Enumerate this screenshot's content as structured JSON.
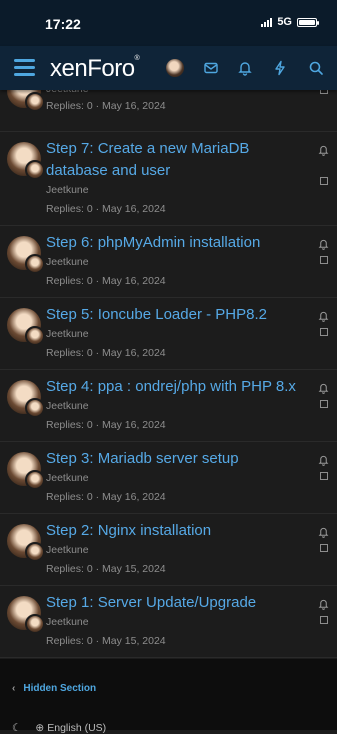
{
  "status_bar": {
    "time": "17:22",
    "network": "5G"
  },
  "header": {
    "logo": "xenForo"
  },
  "threads": [
    {
      "title": "",
      "author": "Jeetkune",
      "meta": "Replies: 0 · May 16, 2024"
    },
    {
      "title": "Step 7: Create a new MariaDB database and user",
      "author": "Jeetkune",
      "meta": "Replies: 0 · May 16, 2024"
    },
    {
      "title": "Step 6: phpMyAdmin installation",
      "author": "Jeetkune",
      "meta": "Replies: 0 · May 16, 2024"
    },
    {
      "title": "Step 5: Ioncube Loader - PHP8.2",
      "author": "Jeetkune",
      "meta": "Replies: 0 · May 16, 2024"
    },
    {
      "title": "Step 4: ppa : ondrej/php with PHP 8.x",
      "author": "Jeetkune",
      "meta": "Replies: 0 · May 16, 2024"
    },
    {
      "title": "Step 3: Mariadb server setup",
      "author": "Jeetkune",
      "meta": "Replies: 0 · May 16, 2024"
    },
    {
      "title": "Step 2: Nginx installation",
      "author": "Jeetkune",
      "meta": "Replies: 0 · May 15, 2024"
    },
    {
      "title": "Step 1: Server Update/Upgrade",
      "author": "Jeetkune",
      "meta": "Replies: 0 · May 15, 2024"
    }
  ],
  "footer": {
    "section_link": "Hidden Section",
    "language": "English (US)"
  },
  "colors": {
    "link": "#56a9e6",
    "nav_bg": "#0f2438",
    "body_bg": "#1c1c1c"
  }
}
